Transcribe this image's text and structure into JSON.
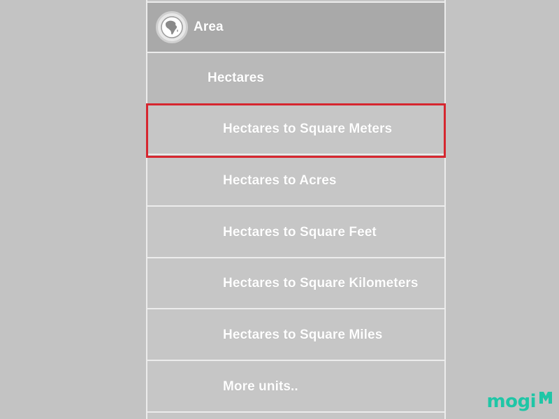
{
  "menu": {
    "header": {
      "label": "Area",
      "icon": "globe-africa-icon"
    },
    "sub": {
      "label": "Hectares"
    },
    "items": [
      {
        "label": "Hectares to Square Meters",
        "highlighted": true
      },
      {
        "label": "Hectares to Acres"
      },
      {
        "label": "Hectares to Square Feet"
      },
      {
        "label": "Hectares to Square Kilometers"
      },
      {
        "label": "Hectares to Square Miles"
      },
      {
        "label": "More units.."
      }
    ]
  },
  "watermark": {
    "text": "mogi",
    "logo": "mogi-m-logo-icon",
    "color": "#1fc6a6"
  },
  "colors": {
    "background": "#c3c3c3",
    "header": "#a9a9a9",
    "sub": "#b9b9b9",
    "item": "#c6c6c6",
    "divider": "#ececec",
    "highlight_border": "#d6262f"
  }
}
